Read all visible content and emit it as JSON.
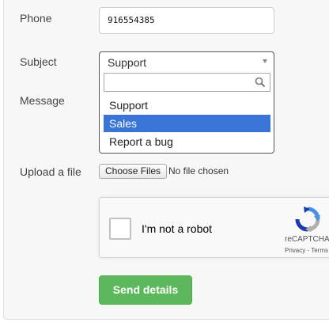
{
  "form": {
    "phone": {
      "label": "Phone",
      "value": "916554385"
    },
    "subject": {
      "label": "Subject",
      "selected": "Support",
      "search_value": "",
      "options": [
        "Support",
        "Sales",
        "Report a bug"
      ],
      "highlighted_option": "Sales"
    },
    "message": {
      "label": "Message"
    },
    "upload": {
      "label": "Upload a file",
      "button_label": "Choose Files",
      "status": "No file chosen"
    },
    "captcha": {
      "checkbox_label": "I'm not a robot",
      "brand": "reCAPTCHA",
      "privacy": "Privacy",
      "separator": "-",
      "terms": "Terms"
    },
    "submit": {
      "label": "Send details",
      "color": "#5cb85c"
    }
  },
  "icons": {
    "search": "search-icon",
    "caret": "chevron-down-icon",
    "captcha_logo": "recaptcha-logo-icon"
  },
  "colors": {
    "highlight": "#3875d7",
    "panel_bg": "#f7f7f7"
  }
}
